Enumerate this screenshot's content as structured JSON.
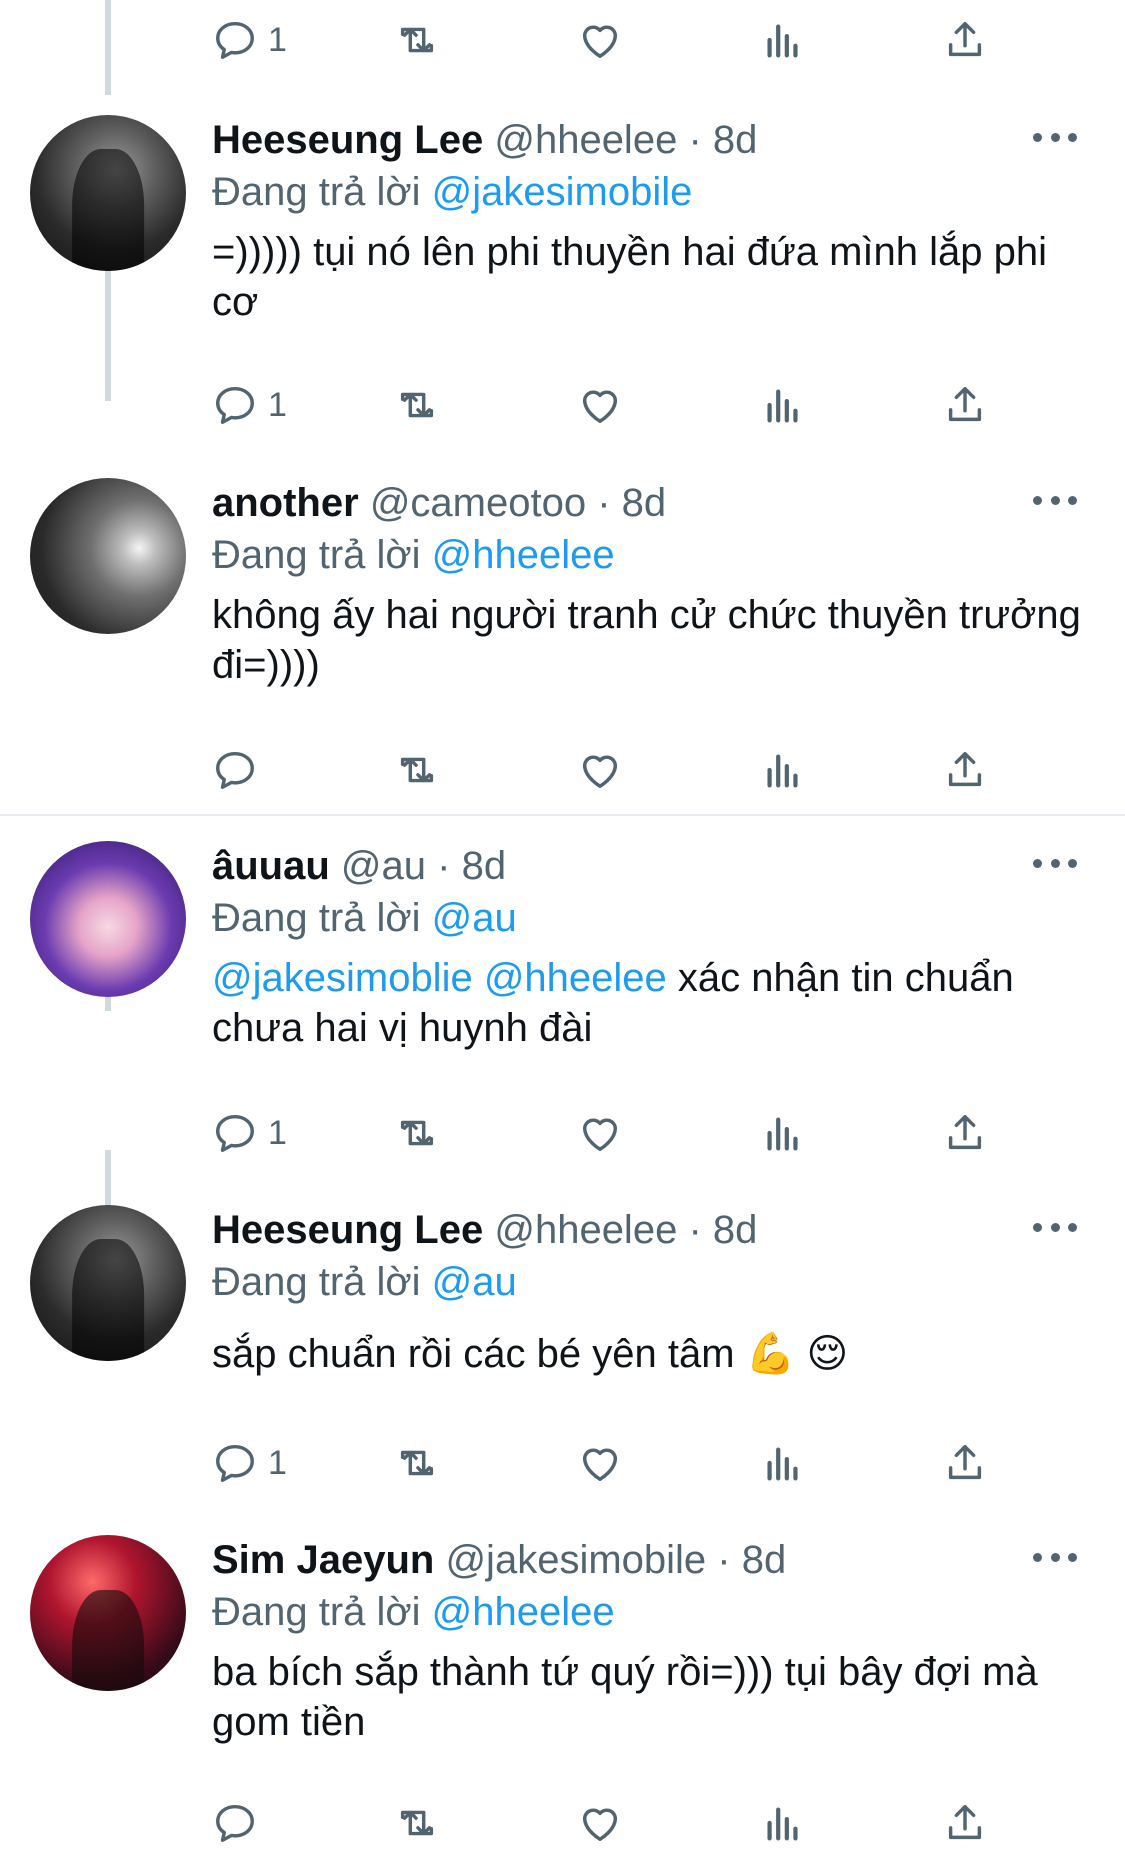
{
  "tweets": [
    {
      "name": "Heeseung Lee",
      "handle": "@hheelee",
      "time": "8d",
      "reply_prefix": "Đang trả lời",
      "reply_to": "@jakesimobile",
      "body": "=))))) tụi nó lên phi thuyền hai đứa mình lắp phi cơ",
      "reply_count": "1",
      "avatar": "dark"
    },
    {
      "name": "another",
      "handle": "@cameotoo",
      "time": "8d",
      "reply_prefix": "Đang trả lời",
      "reply_to": "@hheelee",
      "body": "không ấy hai người tranh cử chức thuyền trưởng đi=))))",
      "reply_count": "",
      "avatar": "grey"
    },
    {
      "name": "âuuau",
      "handle": "@au",
      "time": "8d",
      "reply_prefix": "Đang trả lời",
      "reply_to": "@au",
      "body_mentions": "@jakesimoblie @hheelee",
      "body": " xác nhận tin chuẩn chưa hai vị huynh đài",
      "reply_count": "1",
      "avatar": "anime"
    },
    {
      "name": "Heeseung Lee",
      "handle": "@hheelee",
      "time": "8d",
      "reply_prefix": "Đang trả lời",
      "reply_to": "@au",
      "body": "sắp chuẩn rồi các bé yên tâm 💪 😌",
      "reply_count": "1",
      "avatar": "dark"
    },
    {
      "name": "Sim Jaeyun",
      "handle": "@jakesimobile",
      "time": "8d",
      "reply_prefix": "Đang trả lời",
      "reply_to": "@hheelee",
      "body": "ba bích sắp thành tứ quý rồi=))) tụi bây đợi mà gom tiền",
      "reply_count": "",
      "avatar": "red"
    }
  ],
  "top_action_bar": {
    "reply_count": "1"
  },
  "separator_dot": "·",
  "icons": {
    "reply": "reply-icon",
    "retweet": "retweet-icon",
    "like": "heart-icon",
    "views": "views-icon",
    "share": "share-icon",
    "more": "more-icon"
  },
  "colors": {
    "mention": "#1d9bf0",
    "muted": "#536471",
    "text": "#0f1419"
  }
}
